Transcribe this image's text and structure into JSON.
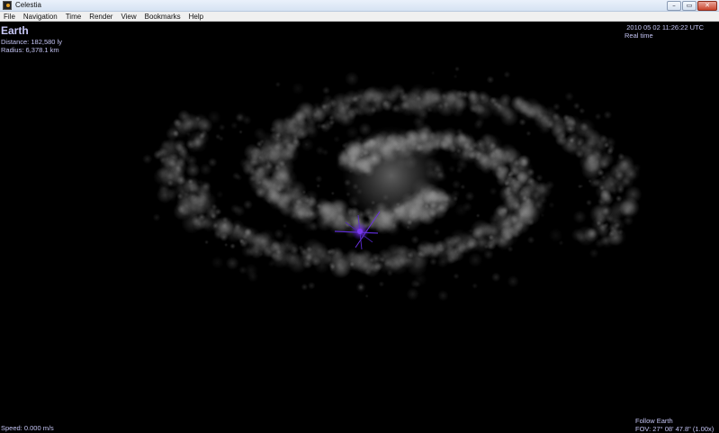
{
  "window": {
    "title": "Celestia",
    "controls": {
      "minimize": "–",
      "maximize": "▭",
      "close": "✕"
    }
  },
  "menu": {
    "items": [
      {
        "label": "File"
      },
      {
        "label": "Navigation"
      },
      {
        "label": "Time"
      },
      {
        "label": "Render"
      },
      {
        "label": "View"
      },
      {
        "label": "Bookmarks"
      },
      {
        "label": "Help"
      }
    ]
  },
  "hud": {
    "object_name": "Earth",
    "distance": "Distance: 182,580 ly",
    "radius": "Radius: 6,378.1 km",
    "datetime": "2010 05 02 11:26:22 UTC",
    "time_mode": "Real time",
    "speed": "Speed: 0.000 m/s",
    "follow": "Follow Earth",
    "fov": "FOV: 27° 08' 47.8\" (1.00x)"
  },
  "scene": {
    "galaxy_color": "#8a8a8a",
    "marker_color": "#6a2adf",
    "background": "#000000"
  }
}
